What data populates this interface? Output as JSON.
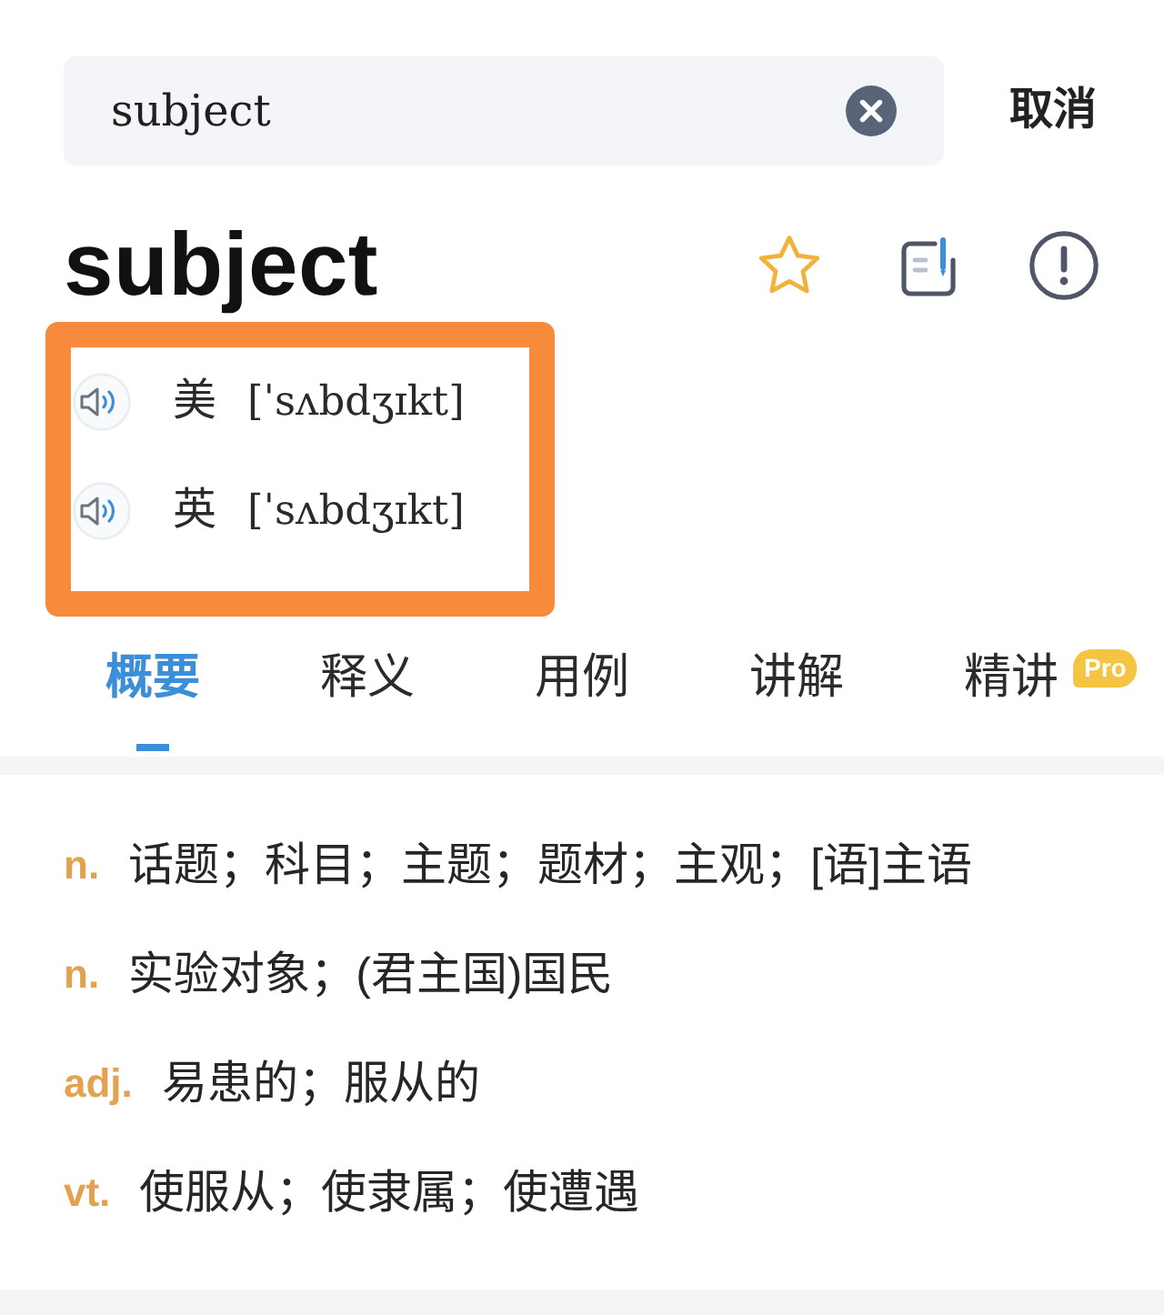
{
  "search": {
    "value": "subject",
    "cancel": "取消"
  },
  "entry": {
    "headword": "subject"
  },
  "pronunciations": {
    "highlighted": true,
    "items": [
      {
        "label": "美",
        "phonetic": "[ˈsʌbdʒɪkt]"
      },
      {
        "label": "英",
        "phonetic": "[ˈsʌbdʒɪkt]"
      }
    ]
  },
  "tabs": [
    {
      "label": "概要",
      "selected": true
    },
    {
      "label": "释义",
      "selected": false
    },
    {
      "label": "用例",
      "selected": false
    },
    {
      "label": "讲解",
      "selected": false
    },
    {
      "label": "精讲",
      "selected": false,
      "badge": "Pro"
    }
  ],
  "definitions": [
    {
      "pos": "n.",
      "text": "话题；科目；主题；题材；主观；[语]主语"
    },
    {
      "pos": "n.",
      "text": "实验对象；(君主国)国民"
    },
    {
      "pos": "adj.",
      "text": "易患的；服从的"
    },
    {
      "pos": "vt.",
      "text": "使服从；使隶属；使遭遇"
    }
  ]
}
